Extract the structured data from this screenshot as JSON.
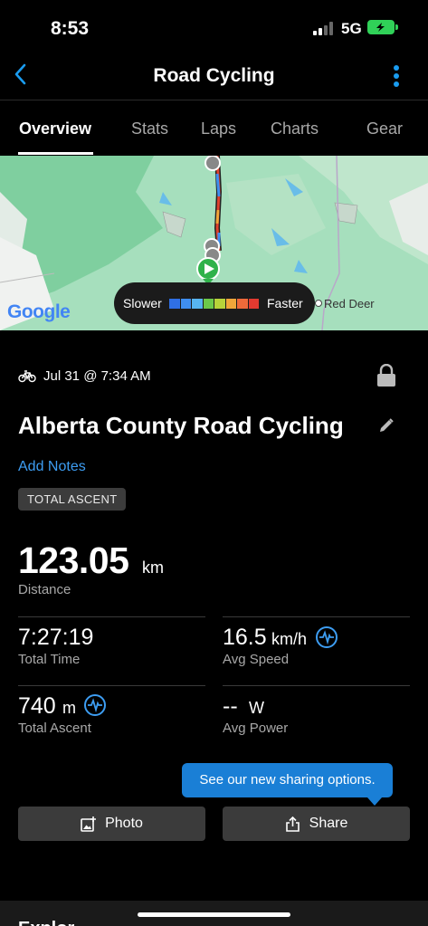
{
  "status_bar": {
    "time": "8:53",
    "network": "5G"
  },
  "nav": {
    "title": "Road Cycling"
  },
  "tabs": [
    {
      "label": "Overview"
    },
    {
      "label": "Stats"
    },
    {
      "label": "Laps"
    },
    {
      "label": "Charts"
    },
    {
      "label": "Gear"
    }
  ],
  "map": {
    "legend": {
      "slower": "Slower",
      "faster": "Faster",
      "colors": [
        "#2f6fe4",
        "#3f8ef0",
        "#57b4f0",
        "#6cc94a",
        "#b7d33a",
        "#f0a63a",
        "#ef6a3a",
        "#e23a30"
      ]
    },
    "provider": "Google",
    "city": "Red Deer"
  },
  "activity": {
    "date": "Jul 31 @ 7:34 AM",
    "title": "Alberta County Road Cycling",
    "add_notes": "Add Notes",
    "badge": "TOTAL ASCENT"
  },
  "stats": {
    "distance": {
      "value": "123.05",
      "unit": "km",
      "label": "Distance"
    },
    "total_time": {
      "value": "7:27:19",
      "label": "Total Time"
    },
    "avg_speed": {
      "value": "16.5",
      "unit": "km/h",
      "label": "Avg Speed"
    },
    "total_ascent": {
      "value": "740",
      "unit": "m",
      "label": "Total Ascent"
    },
    "avg_power": {
      "value": "--",
      "unit": "W",
      "label": "Avg Power"
    }
  },
  "sharing": {
    "tooltip": "See our new sharing options.",
    "photo_label": "Photo",
    "share_label": "Share"
  },
  "bottom": {
    "section_title": "Explor..."
  },
  "colors": {
    "accent": "#3d9df2",
    "tooltip": "#1a7fd6",
    "battery": "#30d158"
  }
}
